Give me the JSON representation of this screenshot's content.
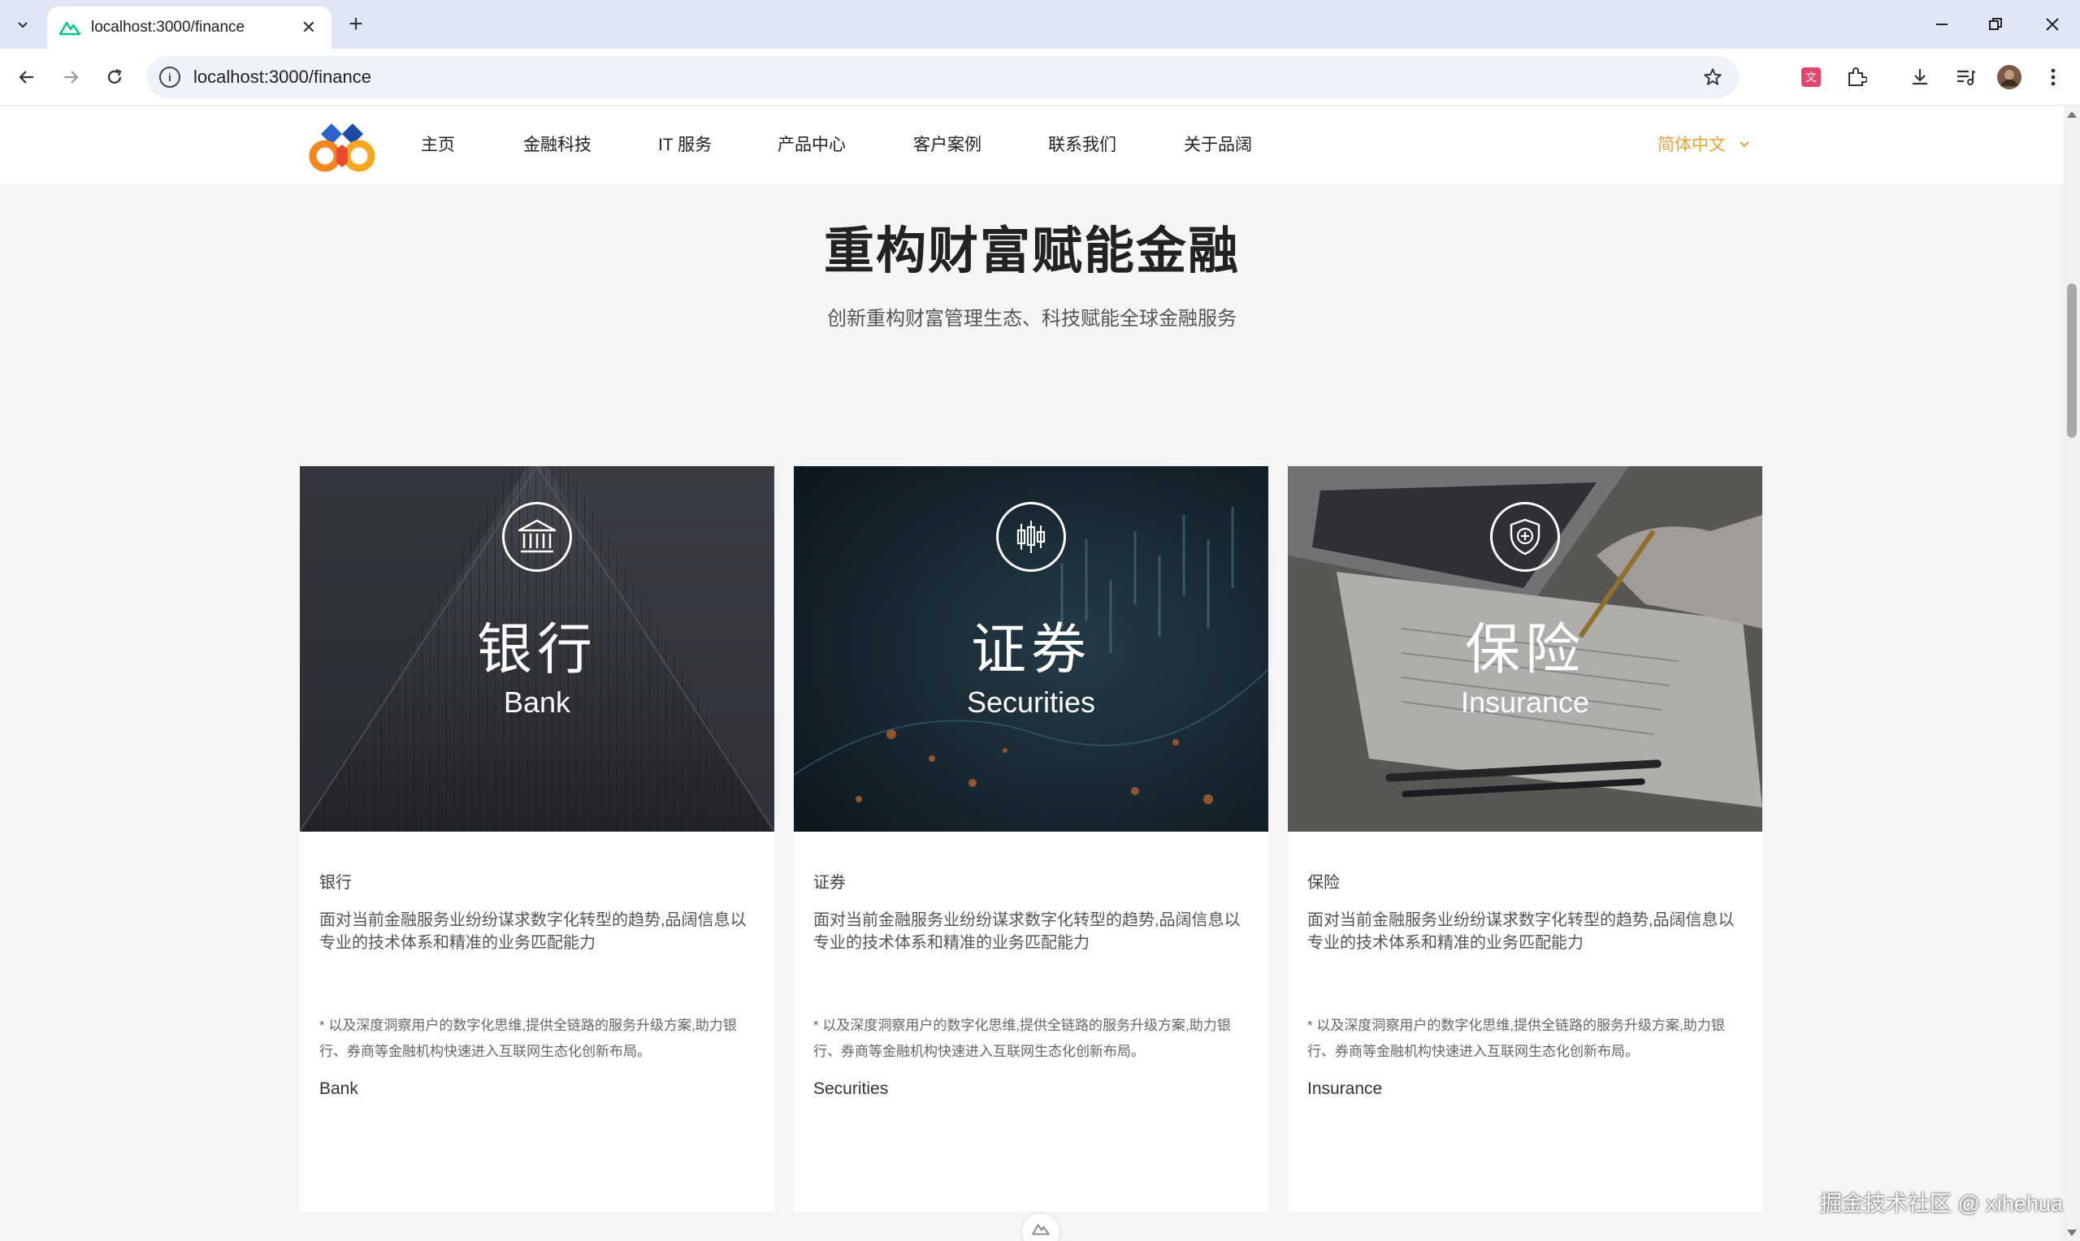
{
  "browser": {
    "tab_title": "localhost:3000/finance",
    "url": "localhost:3000/finance"
  },
  "nav": {
    "items": [
      "主页",
      "金融科技",
      "IT 服务",
      "产品中心",
      "客户案例",
      "联系我们",
      "关于品阔"
    ],
    "language": "简体中文"
  },
  "hero": {
    "title": "重构财富赋能金融",
    "subtitle": "创新重构财富管理生态、科技赋能全球金融服务"
  },
  "cards": [
    {
      "cn": "银行",
      "en": "Bank",
      "label": "银行",
      "desc": "面对当前金融服务业纷纷谋求数字化转型的趋势,品阔信息以专业的技术体系和精准的业务匹配能力",
      "note": "* 以及深度洞察用户的数字化思维,提供全链路的服务升级方案,助力银行、券商等金融机构快速进入互联网生态化创新布局。",
      "en_label": "Bank",
      "icon": "bank-icon"
    },
    {
      "cn": "证券",
      "en": "Securities",
      "label": "证券",
      "desc": "面对当前金融服务业纷纷谋求数字化转型的趋势,品阔信息以专业的技术体系和精准的业务匹配能力",
      "note": "* 以及深度洞察用户的数字化思维,提供全链路的服务升级方案,助力银行、券商等金融机构快速进入互联网生态化创新布局。",
      "en_label": "Securities",
      "icon": "candlestick-icon"
    },
    {
      "cn": "保险",
      "en": "Insurance",
      "label": "保险",
      "desc": "面对当前金融服务业纷纷谋求数字化转型的趋势,品阔信息以专业的技术体系和精准的业务匹配能力",
      "note": "* 以及深度洞察用户的数字化思维,提供全链路的服务升级方案,助力银行、券商等金融机构快速进入互联网生态化创新布局。",
      "en_label": "Insurance",
      "icon": "shield-plus-icon"
    }
  ],
  "watermark": "掘金技术社区 @ xihehua",
  "colors": {
    "accent": "#e8a33a",
    "tabbar": "#dfe7f7",
    "page_bg": "#f5f5f5"
  }
}
